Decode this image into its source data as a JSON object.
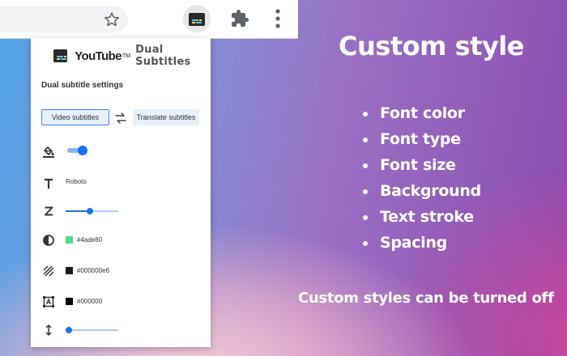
{
  "browser": {
    "icons": [
      "star-icon",
      "app-icon",
      "puzzle-icon",
      "kebab-menu-icon"
    ]
  },
  "popup": {
    "brand_youtube": "YouTube",
    "brand_tm": "TM",
    "brand_product": "Dual Subtitles",
    "settings_title": "Dual subtitle settings",
    "tabs": [
      {
        "label": "Video subtitles",
        "selected": true
      },
      {
        "label": "Translate subtitles",
        "selected": false
      }
    ],
    "rows": {
      "custom_style_enabled": true,
      "font_type": "Roboto",
      "font_size_level": 0.4,
      "font_color": "#4ade80",
      "background_color": "#000000e6",
      "stroke_color": "#000000",
      "spacing_level": 0.0
    },
    "accent": "#1a73e8"
  },
  "hero": {
    "title": "Custom style",
    "features": [
      "Font color",
      "Font type",
      "Font size",
      "Background",
      "Text stroke",
      "Spacing"
    ],
    "footer": "Custom styles can be turned off"
  }
}
